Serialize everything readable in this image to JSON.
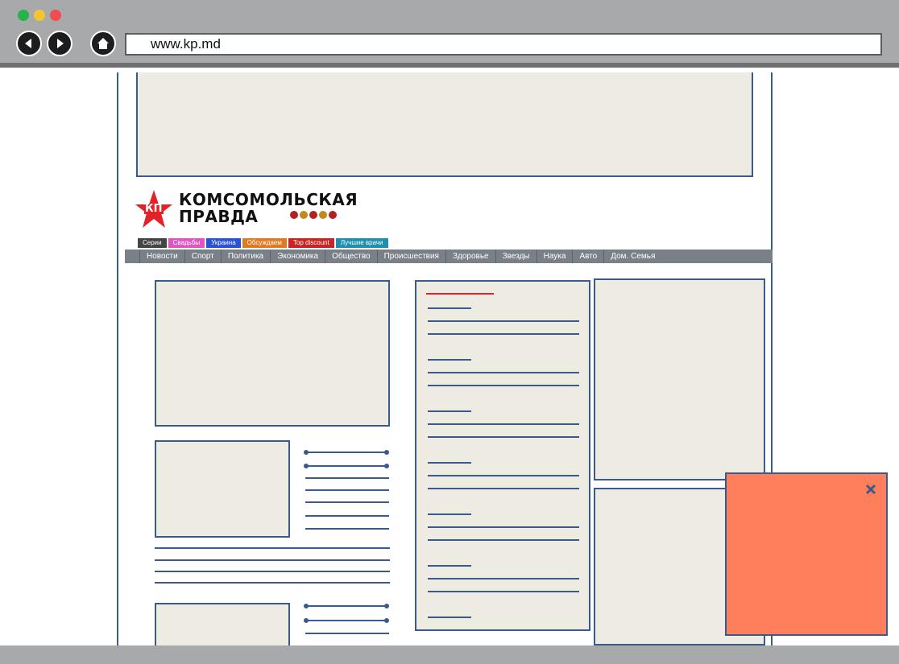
{
  "browser": {
    "url": "www.kp.md",
    "colors": {
      "close": "#ef4d52",
      "minimize": "#f4c433",
      "maximize": "#29b24a"
    }
  },
  "site": {
    "logo_line1": "КОМСОМОЛЬСКАЯ",
    "logo_line2": "ПРАВДА",
    "logo_badge": "КП",
    "topics": [
      {
        "label": "Серии",
        "color": "#444444"
      },
      {
        "label": "Свадьбы",
        "color": "#e055c2"
      },
      {
        "label": "Украина",
        "color": "#2a52d4"
      },
      {
        "label": "Обсуждаем",
        "color": "#e07a22"
      },
      {
        "label": "Top discount",
        "color": "#c92323"
      },
      {
        "label": "Лучшие врачи",
        "color": "#1f8fb0"
      }
    ],
    "menu": [
      "Новости",
      "Спорт",
      "Политика",
      "Экономика",
      "Общество",
      "Происшествия",
      "Здоровье",
      "Звезды",
      "Наука",
      "Авто",
      "Дом. Семья"
    ]
  },
  "popup": {
    "close_icon": "close-icon",
    "color": "#ff7f5c"
  }
}
